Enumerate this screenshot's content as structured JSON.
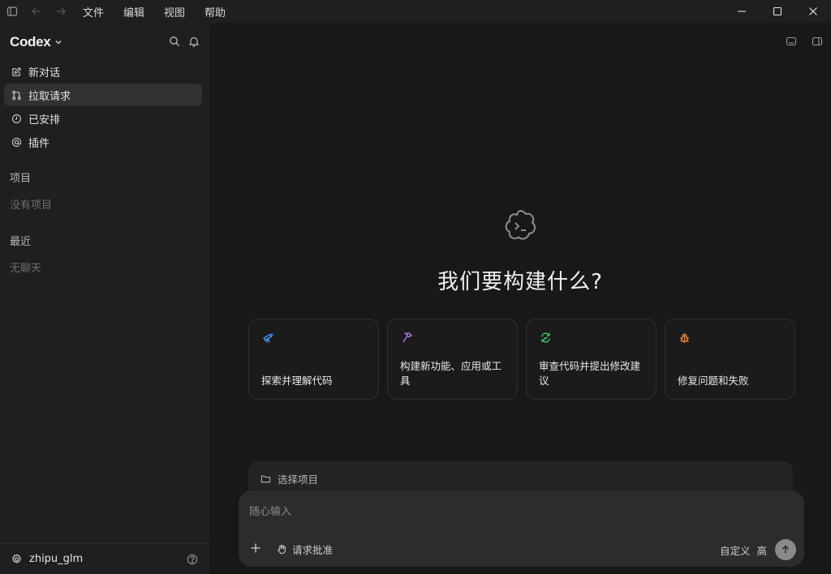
{
  "menu": [
    "文件",
    "编辑",
    "视图",
    "帮助"
  ],
  "sidebar": {
    "brand": "Codex",
    "nav": [
      {
        "label": "新对话",
        "icon": "edit-icon"
      },
      {
        "label": "拉取请求",
        "icon": "pull-request-icon"
      },
      {
        "label": "已安排",
        "icon": "clock-icon"
      },
      {
        "label": "插件",
        "icon": "at-icon"
      }
    ],
    "projects_title": "项目",
    "projects_empty": "没有项目",
    "recent_title": "最近",
    "recent_empty": "无聊天",
    "user": "zhipu_glm"
  },
  "main": {
    "title": "我们要构建什么?",
    "cards": [
      {
        "label": "探索并理解代码",
        "icon": "telescope-icon",
        "color": "#4a9eff"
      },
      {
        "label": "构建新功能、应用或工具",
        "icon": "hammer-icon",
        "color": "#b17cf0"
      },
      {
        "label": "审查代码并提出修改建议",
        "icon": "review-icon",
        "color": "#3ecf6e"
      },
      {
        "label": "修复问题和失败",
        "icon": "bug-icon",
        "color": "#f08a3a"
      }
    ],
    "project_select": "选择项目",
    "composer": {
      "placeholder": "随心输入",
      "approve": "请求批准",
      "mode": "自定义",
      "level": "高"
    }
  },
  "colors": {
    "background": "#1d1f20",
    "main_background": "#181818",
    "active_item": "#2f3133"
  }
}
